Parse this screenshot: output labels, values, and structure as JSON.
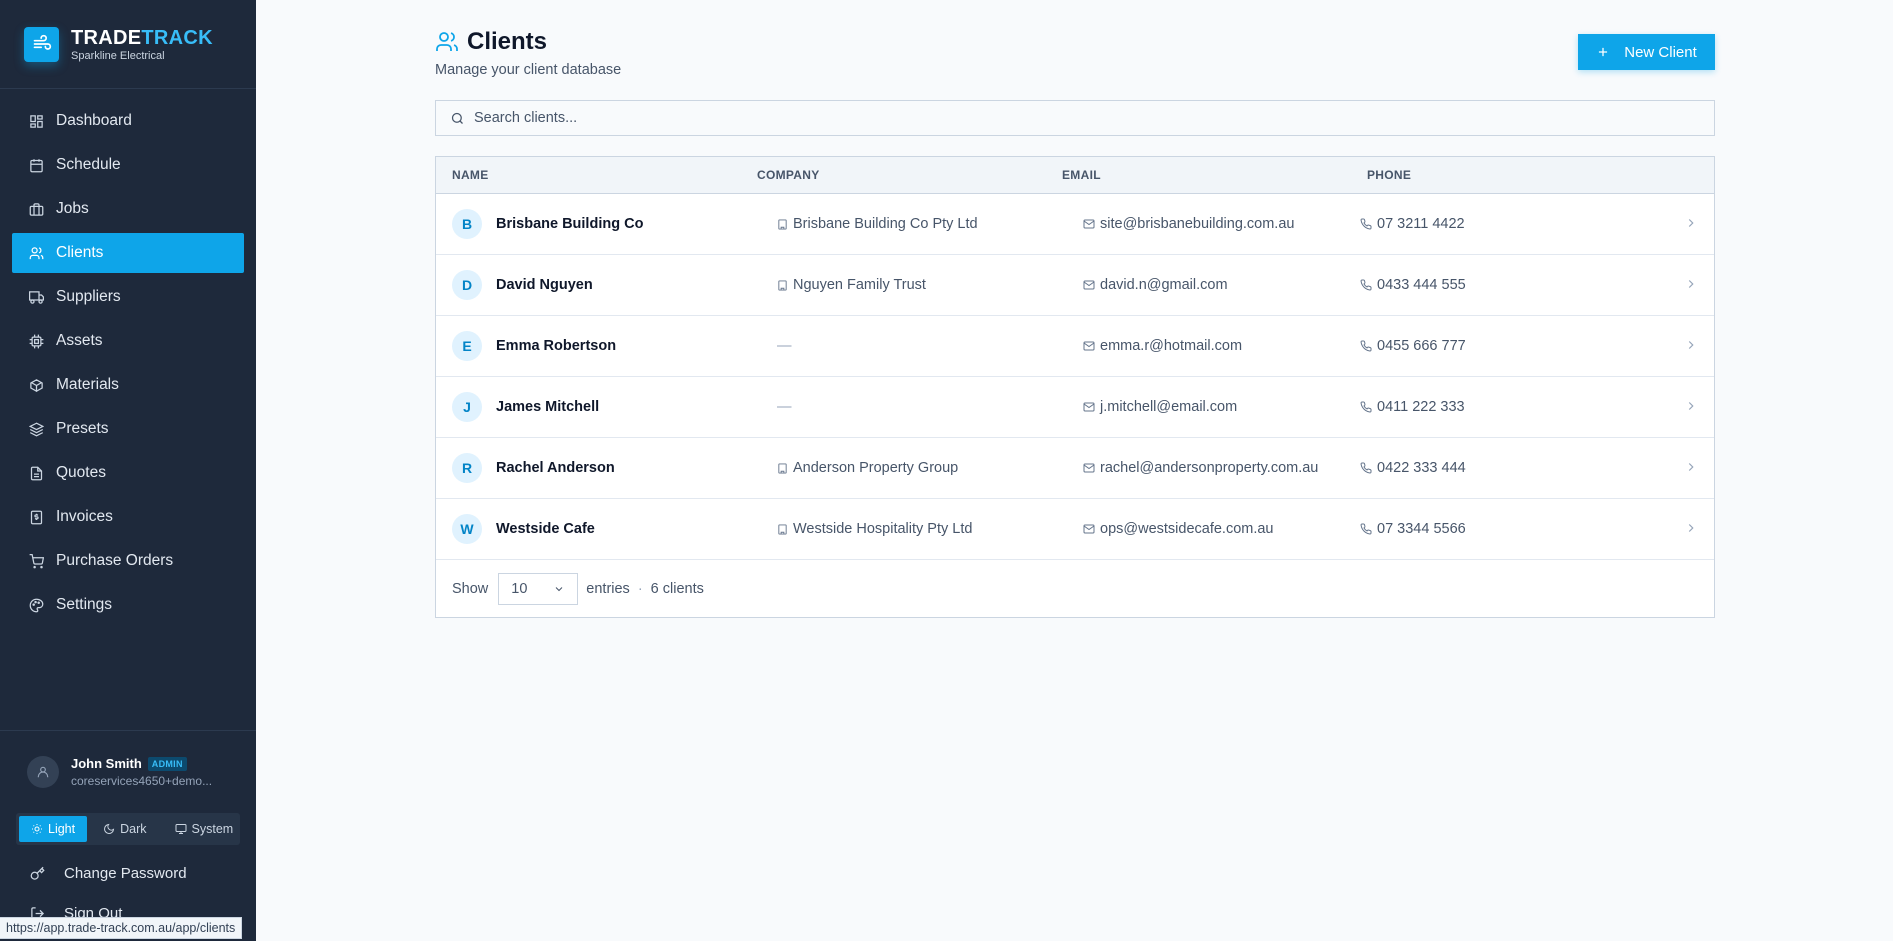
{
  "brand": {
    "name_part1": "TRADE",
    "name_part2": "TRACK",
    "subtitle": "Sparkline Electrical"
  },
  "nav": [
    {
      "label": "Dashboard",
      "icon": "dashboard-icon",
      "active": false
    },
    {
      "label": "Schedule",
      "icon": "calendar-icon",
      "active": false
    },
    {
      "label": "Jobs",
      "icon": "briefcase-icon",
      "active": false
    },
    {
      "label": "Clients",
      "icon": "users-icon",
      "active": true
    },
    {
      "label": "Suppliers",
      "icon": "truck-icon",
      "active": false
    },
    {
      "label": "Assets",
      "icon": "chip-icon",
      "active": false
    },
    {
      "label": "Materials",
      "icon": "box-icon",
      "active": false
    },
    {
      "label": "Presets",
      "icon": "layers-icon",
      "active": false
    },
    {
      "label": "Quotes",
      "icon": "document-icon",
      "active": false
    },
    {
      "label": "Invoices",
      "icon": "receipt-icon",
      "active": false
    },
    {
      "label": "Purchase Orders",
      "icon": "cart-icon",
      "active": false
    },
    {
      "label": "Settings",
      "icon": "palette-icon",
      "active": false
    }
  ],
  "user": {
    "name": "John Smith",
    "role": "ADMIN",
    "email": "coreservices4650+demo..."
  },
  "theme": {
    "light": "Light",
    "dark": "Dark",
    "system": "System",
    "selected": "Light"
  },
  "links": {
    "change_password": "Change Password",
    "sign_out": "Sign Out"
  },
  "status_url": "https://app.trade-track.com.au/app/clients",
  "page": {
    "title": "Clients",
    "subtitle": "Manage your client database",
    "new_button": "New Client",
    "search_placeholder": "Search clients..."
  },
  "table": {
    "headers": {
      "name": "NAME",
      "company": "COMPANY",
      "email": "EMAIL",
      "phone": "PHONE"
    },
    "rows": [
      {
        "initial": "B",
        "name": "Brisbane Building Co",
        "company": "Brisbane Building Co Pty Ltd",
        "email": "site@brisbanebuilding.com.au",
        "phone": "07 3211 4422"
      },
      {
        "initial": "D",
        "name": "David Nguyen",
        "company": "Nguyen Family Trust",
        "email": "david.n@gmail.com",
        "phone": "0433 444 555"
      },
      {
        "initial": "E",
        "name": "Emma Robertson",
        "company": "—",
        "email": "emma.r@hotmail.com",
        "phone": "0455 666 777"
      },
      {
        "initial": "J",
        "name": "James Mitchell",
        "company": "—",
        "email": "j.mitchell@email.com",
        "phone": "0411 222 333"
      },
      {
        "initial": "R",
        "name": "Rachel Anderson",
        "company": "Anderson Property Group",
        "email": "rachel@andersonproperty.com.au",
        "phone": "0422 333 444"
      },
      {
        "initial": "W",
        "name": "Westside Cafe",
        "company": "Westside Hospitality Pty Ltd",
        "email": "ops@westsidecafe.com.au",
        "phone": "07 3344 5566"
      }
    ],
    "footer": {
      "show": "Show",
      "page_size": "10",
      "entries": "entries",
      "separator": "·",
      "count": "6 clients"
    }
  },
  "colors": {
    "accent": "#0ea5e9",
    "sidebar": "#1e293b",
    "background": "#f8fafc"
  }
}
